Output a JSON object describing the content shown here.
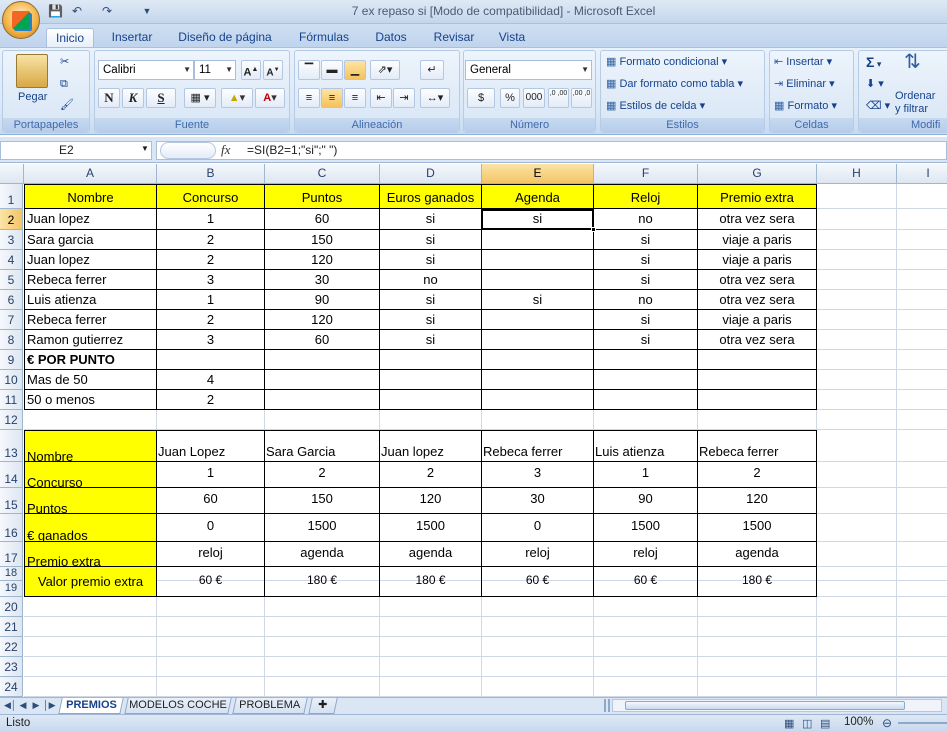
{
  "window": {
    "title": "7 ex repaso si  [Modo de compatibilidad] - Microsoft Excel"
  },
  "tabs": [
    "Inicio",
    "Insertar",
    "Diseño de página",
    "Fórmulas",
    "Datos",
    "Revisar",
    "Vista"
  ],
  "ribbon": {
    "clipboard": {
      "label": "Portapapeles",
      "paste": "Pegar"
    },
    "font": {
      "label": "Fuente",
      "name": "Calibri",
      "size": "11",
      "bold": "N",
      "italic": "K",
      "underline": "S"
    },
    "align": {
      "label": "Alineación"
    },
    "number": {
      "label": "Número",
      "format": "General",
      "currency": "$",
      "percent": "%",
      "thousands": "000",
      "inc_dec": ",0 ,00",
      "dec_dec": ",00 ,0"
    },
    "styles": {
      "label": "Estilos",
      "cond": "Formato condicional",
      "table": "Dar formato como tabla",
      "cell": "Estilos de celda"
    },
    "cells": {
      "label": "Celdas",
      "insert": "Insertar",
      "delete": "Eliminar",
      "format": "Formato"
    },
    "editing": {
      "label": "Modifi",
      "sort1": "Ordenar",
      "sort2": "y filtrar"
    }
  },
  "formula_bar": {
    "name_box": "E2",
    "fx": "fx",
    "formula": "=SI(B2=1;\"si\";\" \")"
  },
  "columns": [
    "A",
    "B",
    "C",
    "D",
    "E",
    "F",
    "G",
    "H",
    "I"
  ],
  "rows": [
    "1",
    "2",
    "3",
    "4",
    "5",
    "6",
    "7",
    "8",
    "9",
    "10",
    "11",
    "12",
    "13",
    "14",
    "15",
    "16",
    "17",
    "18",
    "19",
    "20",
    "21",
    "22",
    "23",
    "24"
  ],
  "table1": {
    "headers": [
      "Nombre",
      "Concurso",
      "Puntos",
      "Euros ganados",
      "Agenda",
      "Reloj",
      "Premio extra"
    ],
    "rows": [
      [
        "Juan lopez",
        "1",
        "60",
        "si",
        "si",
        "no",
        "otra vez sera"
      ],
      [
        "Sara garcia",
        "2",
        "150",
        "si",
        "",
        "si",
        "viaje a paris"
      ],
      [
        "Juan lopez",
        "2",
        "120",
        "si",
        "",
        "si",
        "viaje a paris"
      ],
      [
        "Rebeca ferrer",
        "3",
        "30",
        "no",
        "",
        "si",
        "otra vez sera"
      ],
      [
        "Luis atienza",
        "1",
        "90",
        "si",
        "si",
        "no",
        "otra vez sera"
      ],
      [
        "Rebeca ferrer",
        "2",
        "120",
        "si",
        "",
        "si",
        "viaje a paris"
      ],
      [
        "Ramon gutierrez",
        "3",
        "60",
        "si",
        "",
        "si",
        "otra vez sera"
      ]
    ],
    "euro_title": "€ POR PUNTO",
    "euro_rows": [
      [
        "Mas de 50",
        "4"
      ],
      [
        "50 o menos",
        "2"
      ]
    ]
  },
  "table2": {
    "labels": [
      "Nombre",
      "Concurso",
      "Puntos",
      "€ ganados",
      "Premio extra",
      "Valor premio extra"
    ],
    "names": [
      "Juan Lopez",
      "Sara Garcia",
      "Juan lopez",
      "Rebeca ferrer",
      "Luis atienza",
      "Rebeca ferrer"
    ],
    "concurso": [
      "1",
      "2",
      "2",
      "3",
      "1",
      "2"
    ],
    "puntos": [
      "60",
      "150",
      "120",
      "30",
      "90",
      "120"
    ],
    "ganados": [
      "0",
      "1500",
      "1500",
      "0",
      "1500",
      "1500"
    ],
    "premio": [
      "reloj",
      "agenda",
      "agenda",
      "reloj",
      "reloj",
      "agenda"
    ],
    "valor": [
      "60 €",
      "180 €",
      "180 €",
      "60 €",
      "60 €",
      "180 €"
    ]
  },
  "sheets": [
    "PREMIOS",
    "MODELOS COCHE",
    "PROBLEMA"
  ],
  "status": {
    "text": "Listo",
    "zoom": "100%"
  }
}
